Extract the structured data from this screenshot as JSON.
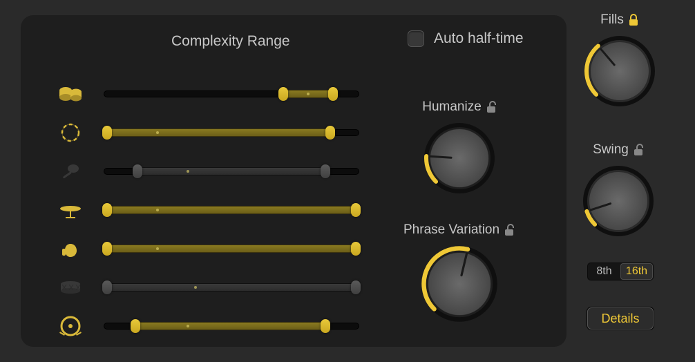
{
  "labels": {
    "complexity": "Complexity Range",
    "autoHalf": "Auto half-time",
    "humanize": "Humanize",
    "phraseVariation": "Phrase Variation",
    "fills": "Fills",
    "swing": "Swing",
    "details": "Details"
  },
  "autoHalfTime": false,
  "colors": {
    "accent": "#efc836",
    "knobFace": "#5a5a5a",
    "knobRing": "#efc836"
  },
  "instruments": [
    {
      "id": "bongos",
      "active": true,
      "range": [
        69,
        91
      ],
      "dot": 80
    },
    {
      "id": "tambourine",
      "active": true,
      "range": [
        0,
        90
      ],
      "dot": 21
    },
    {
      "id": "shaker",
      "active": false,
      "range": [
        12,
        88
      ],
      "dot": 33
    },
    {
      "id": "cymbal",
      "active": true,
      "range": [
        0,
        100
      ],
      "dot": 21
    },
    {
      "id": "clap",
      "active": true,
      "range": [
        0,
        100
      ],
      "dot": 21
    },
    {
      "id": "snare",
      "active": false,
      "range": [
        0,
        100
      ],
      "dot": 36
    },
    {
      "id": "kick",
      "active": true,
      "range": [
        11,
        88
      ],
      "dot": 33
    }
  ],
  "knobs": {
    "humanize": {
      "value": 18,
      "locked": false
    },
    "phraseVariation": {
      "value": 55,
      "locked": false
    },
    "fills": {
      "value": 35,
      "locked": true
    },
    "swing": {
      "value": 10,
      "locked": false
    }
  },
  "swingMode": {
    "options": [
      "8th",
      "16th"
    ],
    "selected": "16th"
  }
}
